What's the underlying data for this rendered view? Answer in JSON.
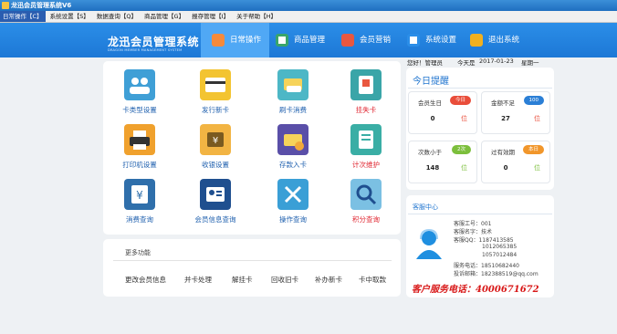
{
  "window": {
    "title": "龙迅会员管理系统V6"
  },
  "menubar": {
    "items": [
      "日常操作【C】",
      "系统设置【S】",
      "数据查询【Q】",
      "商品管理【G】",
      "报存管理【I】",
      "关于帮助【H】"
    ]
  },
  "header": {
    "brand": "龙迅会员管理系统",
    "brand_sub": "DRAGON MEMBER MANAGEMENT SYSTEM",
    "tabs": [
      {
        "label": "日常操作",
        "icon": "daily-icon",
        "color": "#f58a3b"
      },
      {
        "label": "商品管理",
        "icon": "goods-icon",
        "color": "#3aa56a"
      },
      {
        "label": "会员营销",
        "icon": "marketing-icon",
        "color": "#e9573f"
      },
      {
        "label": "系统设置",
        "icon": "settings-icon",
        "color": "#2b8ee8"
      },
      {
        "label": "退出系统",
        "icon": "exit-icon",
        "color": "#f2b01e"
      }
    ]
  },
  "functions": [
    {
      "label": "卡类型设置",
      "icon": "card-type-icon",
      "color": "#3f9fd6",
      "red": false
    },
    {
      "label": "发行新卡",
      "icon": "new-card-icon",
      "color": "#f3c431",
      "red": false
    },
    {
      "label": "刷卡消费",
      "icon": "swipe-card-icon",
      "color": "#4db7c6",
      "red": false
    },
    {
      "label": "挂失卡",
      "icon": "lost-card-icon",
      "color": "#3aa5a8",
      "red": true
    },
    {
      "label": "打印机设置",
      "icon": "printer-icon",
      "color": "#f0a12d",
      "red": false
    },
    {
      "label": "收银设置",
      "icon": "cashier-icon",
      "color": "#f2b443",
      "red": false
    },
    {
      "label": "存款入卡",
      "icon": "deposit-icon",
      "color": "#5a4fa8",
      "red": false
    },
    {
      "label": "计次维护",
      "icon": "count-icon",
      "color": "#3aaea5",
      "red": true
    },
    {
      "label": "消费查询",
      "icon": "consume-query-icon",
      "color": "#2f6fab",
      "red": false
    },
    {
      "label": "会员信息查询",
      "icon": "member-query-icon",
      "color": "#1f4f8f",
      "red": false
    },
    {
      "label": "操作查询",
      "icon": "operation-query-icon",
      "color": "#3a9fd6",
      "red": false
    },
    {
      "label": "积分查询",
      "icon": "points-query-icon",
      "color": "#7bc0e3",
      "red": true
    }
  ],
  "more": {
    "title": "更多功能",
    "links": [
      "更改会员信息",
      "并卡处理",
      "解挂卡",
      "回收旧卡",
      "补办新卡",
      "卡中取款"
    ]
  },
  "userbar": {
    "greeting": "您好！管理员",
    "date_label": "今天是",
    "date": "2017-01-23",
    "weekday": "星期一"
  },
  "reminder": {
    "title": "今日提醒",
    "stats": [
      {
        "label": "会员生日",
        "badge": "今日",
        "badge_color": "#e94d3a",
        "value": "0",
        "unit": "位",
        "unit_color": "#e94d3a"
      },
      {
        "label": "金额不足",
        "badge": "100",
        "badge_color": "#2b7fd6",
        "value": "27",
        "unit": "位",
        "unit_color": "#e94d3a"
      },
      {
        "label": "次数小于",
        "badge": "2次",
        "badge_color": "#7cbf3c",
        "value": "148",
        "unit": "位",
        "unit_color": "#7cbf3c"
      },
      {
        "label": "过有效期",
        "badge": "本日",
        "badge_color": "#f1962b",
        "value": "0",
        "unit": "位",
        "unit_color": "#7cbf3c"
      }
    ]
  },
  "service": {
    "title": "客服中心",
    "rows": [
      "客服工号：001",
      "客服名字：技术",
      "客服QQ：1187413585",
      "1012065385",
      "1057012484",
      "服务电话：18510682440",
      "投诉邮箱：182388519@qq.com"
    ],
    "hotline": "客户服务电话：4000671672"
  }
}
